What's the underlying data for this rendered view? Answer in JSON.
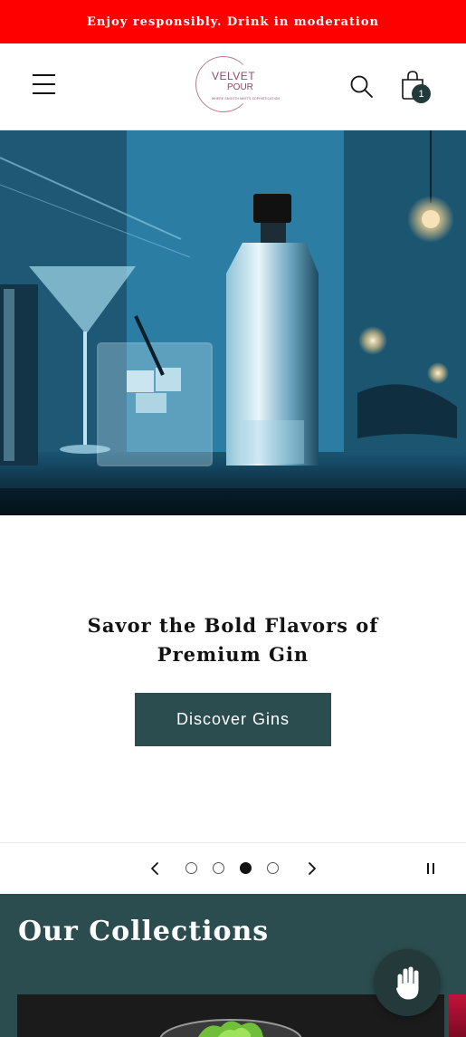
{
  "announcement": {
    "text": "Enjoy responsibly. Drink in moderation"
  },
  "header": {
    "logo_line1": "VELVET",
    "logo_line2": "POUR",
    "logo_tagline": "WHERE SMOOTH MEETS SOPHISTICATION",
    "cart_count": "1",
    "icons": {
      "menu": "hamburger-menu-icon",
      "search": "search-icon",
      "cart": "shopping-bag-icon"
    }
  },
  "hero": {
    "image_label": "gin-bottle-cocktail-bar-image"
  },
  "slide": {
    "heading": "Savor the Bold Flavors of Premium Gin",
    "cta_label": "Discover Gins"
  },
  "slider": {
    "slide_count": 4,
    "active_index": 3,
    "icons": {
      "prev": "chevron-left-icon",
      "next": "chevron-right-icon",
      "pause": "pause-icon"
    }
  },
  "collections": {
    "title": "Our Collections"
  },
  "chat": {
    "icon": "waving-hand-chat-icon"
  },
  "colors": {
    "announcement_bg": "#ff0000",
    "primary": "#2c4d4f",
    "text": "#121212",
    "logo": "#8a4a6a"
  }
}
